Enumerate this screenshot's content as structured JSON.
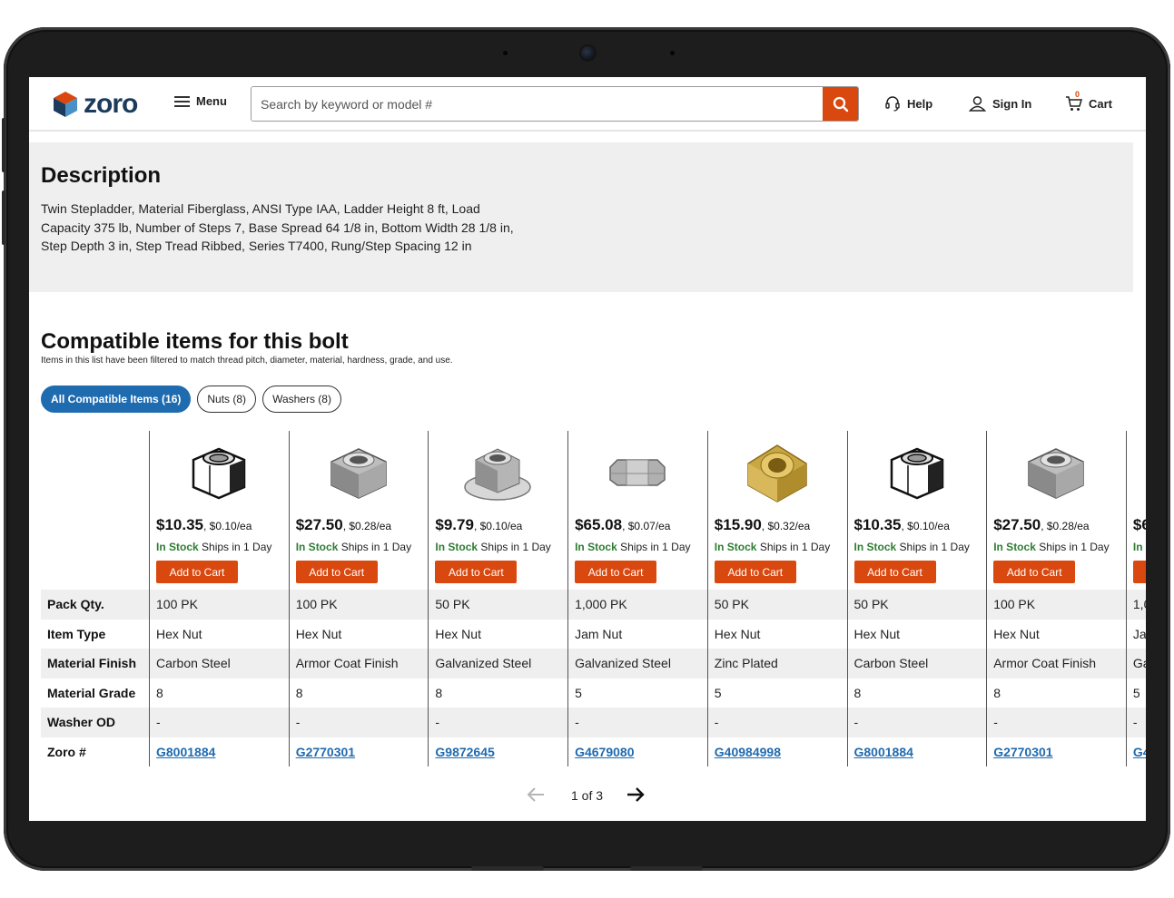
{
  "header": {
    "logo_text": "zoro",
    "menu_label": "Menu",
    "search_placeholder": "Search by keyword or model #",
    "help_label": "Help",
    "signin_label": "Sign In",
    "cart_label": "Cart",
    "cart_count": "0"
  },
  "description": {
    "title": "Description",
    "body": "Twin Stepladder, Material Fiberglass, ANSI Type IAA, Ladder Height 8 ft, Load Capacity 375 lb, Number of Steps 7, Base Spread 64 1/8 in, Bottom Width 28 1/8 in, Step Depth 3 in, Step Tread Ribbed, Series T7400, Rung/Step Spacing 12 in"
  },
  "compatible": {
    "title": "Compatible items for this bolt",
    "subtitle": "Items in this list have been filtered to match thread pitch, diameter, material, hardness, grade, and use.",
    "filters": [
      {
        "label": "All Compatible Items (16)",
        "active": true
      },
      {
        "label": "Nuts (8)",
        "active": false
      },
      {
        "label": "Washers (8)",
        "active": false
      }
    ],
    "row_labels": [
      "Pack Qty.",
      "Item Type",
      "Material Finish",
      "Material Grade",
      "Washer OD",
      "Zoro #"
    ],
    "add_to_cart_label": "Add to Cart",
    "in_stock_label": "In Stock",
    "ships_label": "Ships in 1 Day",
    "products": [
      {
        "image": "hex-nut-outline",
        "price": "$10.35",
        "unit_price": "$0.10/ea",
        "pack_qty": "100 PK",
        "item_type": "Hex Nut",
        "finish": "Carbon Steel",
        "grade": "8",
        "washer_od": "-",
        "zoro": "G8001884"
      },
      {
        "image": "hex-nut-chrome",
        "price": "$27.50",
        "unit_price": "$0.28/ea",
        "pack_qty": "100 PK",
        "item_type": "Hex Nut",
        "finish": "Armor Coat Finish",
        "grade": "8",
        "washer_od": "-",
        "zoro": "G2770301"
      },
      {
        "image": "flange-nut",
        "price": "$9.79",
        "unit_price": "$0.10/ea",
        "pack_qty": "50 PK",
        "item_type": "Hex Nut",
        "finish": "Galvanized Steel",
        "grade": "8",
        "washer_od": "-",
        "zoro": "G9872645"
      },
      {
        "image": "jam-nut",
        "price": "$65.08",
        "unit_price": "$0.07/ea",
        "pack_qty": "1,000 PK",
        "item_type": "Jam Nut",
        "finish": "Galvanized Steel",
        "grade": "5",
        "washer_od": "-",
        "zoro": "G4679080"
      },
      {
        "image": "hex-nut-gold",
        "price": "$15.90",
        "unit_price": "$0.32/ea",
        "pack_qty": "50 PK",
        "item_type": "Hex Nut",
        "finish": "Zinc Plated",
        "grade": "5",
        "washer_od": "-",
        "zoro": "G40984998"
      },
      {
        "image": "hex-nut-outline",
        "price": "$10.35",
        "unit_price": "$0.10/ea",
        "pack_qty": "50 PK",
        "item_type": "Hex Nut",
        "finish": "Carbon Steel",
        "grade": "8",
        "washer_od": "-",
        "zoro": "G8001884"
      },
      {
        "image": "hex-nut-chrome",
        "price": "$27.50",
        "unit_price": "$0.28/ea",
        "pack_qty": "100 PK",
        "item_type": "Hex Nut",
        "finish": "Armor Coat Finish",
        "grade": "8",
        "washer_od": "-",
        "zoro": "G2770301"
      },
      {
        "image": "",
        "price": "$6",
        "unit_price": "",
        "pack_qty": "1,0",
        "item_type": "Ja",
        "finish": "Ga",
        "grade": "5",
        "washer_od": "-",
        "zoro": "G4",
        "in_stock_partial": "In"
      }
    ]
  },
  "pagination": {
    "label": "1 of 3"
  },
  "colors": {
    "brand_orange": "#d9480f",
    "link_blue": "#1f6bb0",
    "stock_green": "#2e7d32",
    "logo_navy": "#1b3a5c"
  }
}
